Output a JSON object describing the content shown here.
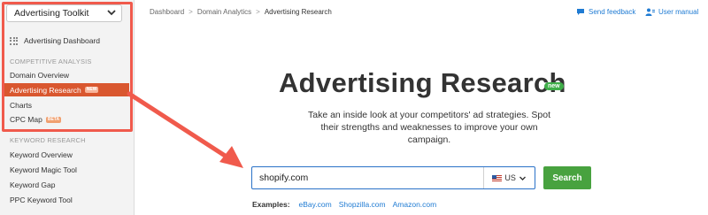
{
  "sidebar": {
    "toolkit_select": "Advertising Toolkit",
    "dashboard": "Advertising Dashboard",
    "competitive_head": "COMPETITIVE ANALYSIS",
    "competitive_items": [
      {
        "label": "Domain Overview"
      },
      {
        "label": "Advertising Research",
        "badge": "NEW"
      },
      {
        "label": "Charts"
      },
      {
        "label": "CPC Map",
        "badge": "BETA"
      }
    ],
    "keyword_head": "KEYWORD RESEARCH",
    "keyword_items": [
      {
        "label": "Keyword Overview"
      },
      {
        "label": "Keyword Magic Tool"
      },
      {
        "label": "Keyword Gap"
      },
      {
        "label": "PPC Keyword Tool"
      }
    ]
  },
  "breadcrumb": [
    "Dashboard",
    "Domain Analytics",
    "Advertising Research"
  ],
  "breadcrumb_sep": ">",
  "header_links": {
    "feedback": "Send feedback",
    "manual": "User manual"
  },
  "hero": {
    "title": "Advertising Research",
    "badge": "new",
    "subtitle": "Take an inside look at your competitors' ad strategies. Spot their strengths and weaknesses to improve your own campaign."
  },
  "search": {
    "value": "shopify.com",
    "database": "US",
    "button": "Search"
  },
  "examples": {
    "label": "Examples:",
    "items": [
      "eBay.com",
      "Shopzilla.com",
      "Amazon.com"
    ]
  },
  "colors": {
    "accent_orange": "#d9572f",
    "highlight_red": "#f05a4c",
    "link_blue": "#1f7bd3",
    "search_green": "#48a23f",
    "badge_green": "#3fae49"
  }
}
